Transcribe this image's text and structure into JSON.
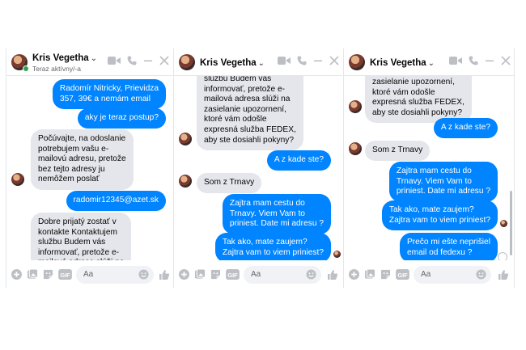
{
  "contact": {
    "name": "Kris Vegetha",
    "status": "Teraz aktívny/-a"
  },
  "composer": {
    "placeholder": "Aa"
  },
  "panel1": {
    "messages": [
      {
        "dir": "out",
        "text": "Radomír Nitricky, Prievidza\n357, 39€ a nemám email"
      },
      {
        "dir": "out",
        "text": "aky je teraz postup?"
      },
      {
        "dir": "in",
        "text": "Počúvajte, na odoslanie\npotrebujem vašu e-\nmailovú adresu, pretože\nbez tejto adresy ju\nnemôžem poslať"
      },
      {
        "dir": "out",
        "text": "radomir12345@azet.sk"
      },
      {
        "dir": "in",
        "text": "Dobre prijatý zostať v\nkontakte Kontaktujem\nslužbu Budem vás\ninformovať, pretože e-\nmailová adresa slúži na"
      }
    ]
  },
  "panel2": {
    "messages": [
      {
        "dir": "in",
        "text": "službu Budem vás\ninformovať, pretože e-\nmailová adresa slúži na\nzasielanie upozornení,\nktoré vám odošle\nexpresná služba FEDEX,\naby ste dosiahli pokyny?"
      },
      {
        "dir": "out",
        "text": "A z kade ste?"
      },
      {
        "dir": "in",
        "text": "Som z Trnavy"
      },
      {
        "dir": "out",
        "text": "Zajtra mam cestu do\nTrnavy. Viem Vam to\npriniest. Date mi adresu ?"
      },
      {
        "dir": "out",
        "text": "Tak ako, mate zaujem?\nZajtra vam to viem priniest?"
      }
    ]
  },
  "panel3": {
    "messages": [
      {
        "dir": "in",
        "text": "zasielanie upozornení,\nktoré vám odošle\nexpresná služba FEDEX,\naby ste dosiahli pokyny?"
      },
      {
        "dir": "out",
        "text": "A z kade ste?"
      },
      {
        "dir": "in",
        "text": "Som z Trnavy"
      },
      {
        "dir": "out",
        "text": "Zajtra mam cestu do\nTrnavy. Viem Vam to\npriniest. Date mi adresu ?"
      },
      {
        "dir": "out",
        "text": "Tak ako, mate zaujem?\nZajtra vam to viem priniest?"
      },
      {
        "dir": "out",
        "text": "Prečo mi ešte neprišiel\nemail od fedexu ?"
      }
    ]
  },
  "colors": {
    "accent": "#0084ff",
    "incoming": "#e4e6eb",
    "online": "#31a24c"
  }
}
